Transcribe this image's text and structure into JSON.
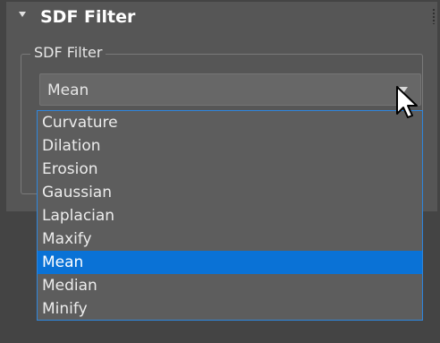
{
  "rollout": {
    "title": "SDF Filter"
  },
  "group": {
    "label": "SDF Filter",
    "combo": {
      "value": "Mean",
      "options": [
        "Curvature",
        "Dilation",
        "Erosion",
        "Gaussian",
        "Laplacian",
        "Maxify",
        "Mean",
        "Median",
        "Minify"
      ],
      "selected_index": 6
    }
  },
  "colors": {
    "selection": "#0a72d6",
    "list_border": "#2f86dd",
    "panel": "#565656"
  },
  "icons": [
    "collapse-triangle-icon",
    "grip-icon",
    "dropdown-arrow-icon",
    "mouse-cursor-icon"
  ]
}
